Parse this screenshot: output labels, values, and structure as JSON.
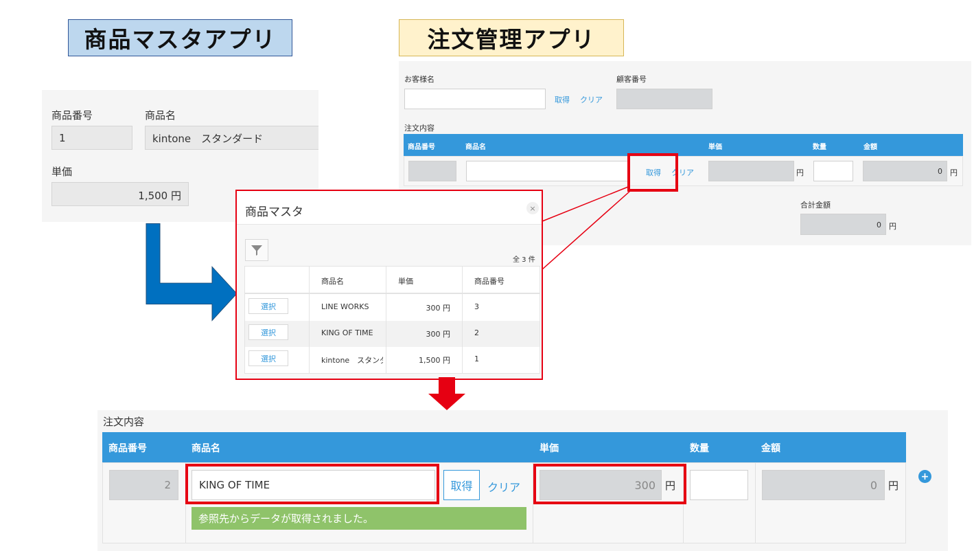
{
  "titles": {
    "master": "商品マスタアプリ",
    "order": "注文管理アプリ"
  },
  "master_form": {
    "product_no_label": "商品番号",
    "product_no_value": "1",
    "product_name_label": "商品名",
    "product_name_value": "kintone　スタンダード",
    "price_label": "単価",
    "price_value": "1,500 円"
  },
  "order_form": {
    "customer_label": "お客様名",
    "customer_no_label": "顧客番号",
    "get_label": "取得",
    "clear_label": "クリア",
    "contents_label": "注文内容",
    "columns": [
      "商品番号",
      "商品名",
      "単価",
      "数量",
      "金額"
    ],
    "yen": "円",
    "amount_value": "0",
    "total_label": "合計金額",
    "total_value": "0"
  },
  "modal": {
    "title": "商品マスタ",
    "close": "×",
    "count": "全 3 件",
    "columns": [
      "商品名",
      "単価",
      "商品番号"
    ],
    "select_label": "選択",
    "rows": [
      {
        "name": "LINE WORKS",
        "price": "300 円",
        "no": "3"
      },
      {
        "name": "KING OF TIME",
        "price": "300 円",
        "no": "2"
      },
      {
        "name": "kintone　スタンダー",
        "price": "1,500 円",
        "no": "1"
      }
    ]
  },
  "result": {
    "contents_label": "注文内容",
    "columns": [
      "商品番号",
      "商品名",
      "単価",
      "数量",
      "金額"
    ],
    "product_no_value": "2",
    "product_name_value": "KING OF TIME",
    "get_label": "取得",
    "clear_label": "クリア",
    "price_value": "300",
    "yen": "円",
    "amount_value": "0",
    "success_message": "参照先からデータが取得されました。",
    "add_icon": "+"
  },
  "colors": {
    "accent": "#3498db",
    "highlight": "#e60012",
    "arrow": "#0070c0",
    "success": "#8fc36a"
  }
}
